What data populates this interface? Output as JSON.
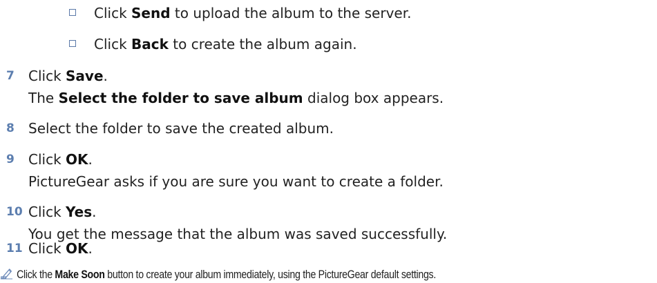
{
  "bullets": [
    {
      "pre": "Click ",
      "bold": "Send",
      "post": " to upload the album to the server."
    },
    {
      "pre": "Click ",
      "bold": "Back",
      "post": " to create the album again."
    }
  ],
  "steps": [
    {
      "number": "7",
      "lines": [
        {
          "pre": "Click ",
          "bold": "Save",
          "post": "."
        },
        {
          "pre": "The ",
          "bold": "Select the folder to save album",
          "post": " dialog box appears."
        }
      ]
    },
    {
      "number": "8",
      "lines": [
        {
          "pre": "Select the folder to save the created album.",
          "bold": "",
          "post": ""
        }
      ]
    },
    {
      "number": "9",
      "lines": [
        {
          "pre": "Click ",
          "bold": "OK",
          "post": "."
        },
        {
          "pre": "PictureGear asks if you are sure you want to create a folder.",
          "bold": "",
          "post": ""
        }
      ]
    },
    {
      "number": "10",
      "lines": [
        {
          "pre": "Click ",
          "bold": "Yes",
          "post": "."
        },
        {
          "pre": "You get the message that the album was saved successfully.",
          "bold": "",
          "post": ""
        }
      ]
    },
    {
      "number": "11",
      "lines": [
        {
          "pre": "Click ",
          "bold": "OK",
          "post": "."
        }
      ]
    }
  ],
  "note": {
    "icon": "pencil-note-icon",
    "pre": "Click the ",
    "bold": "Make Soon",
    "post": " button to create your album immediately, using the PictureGear default settings."
  }
}
